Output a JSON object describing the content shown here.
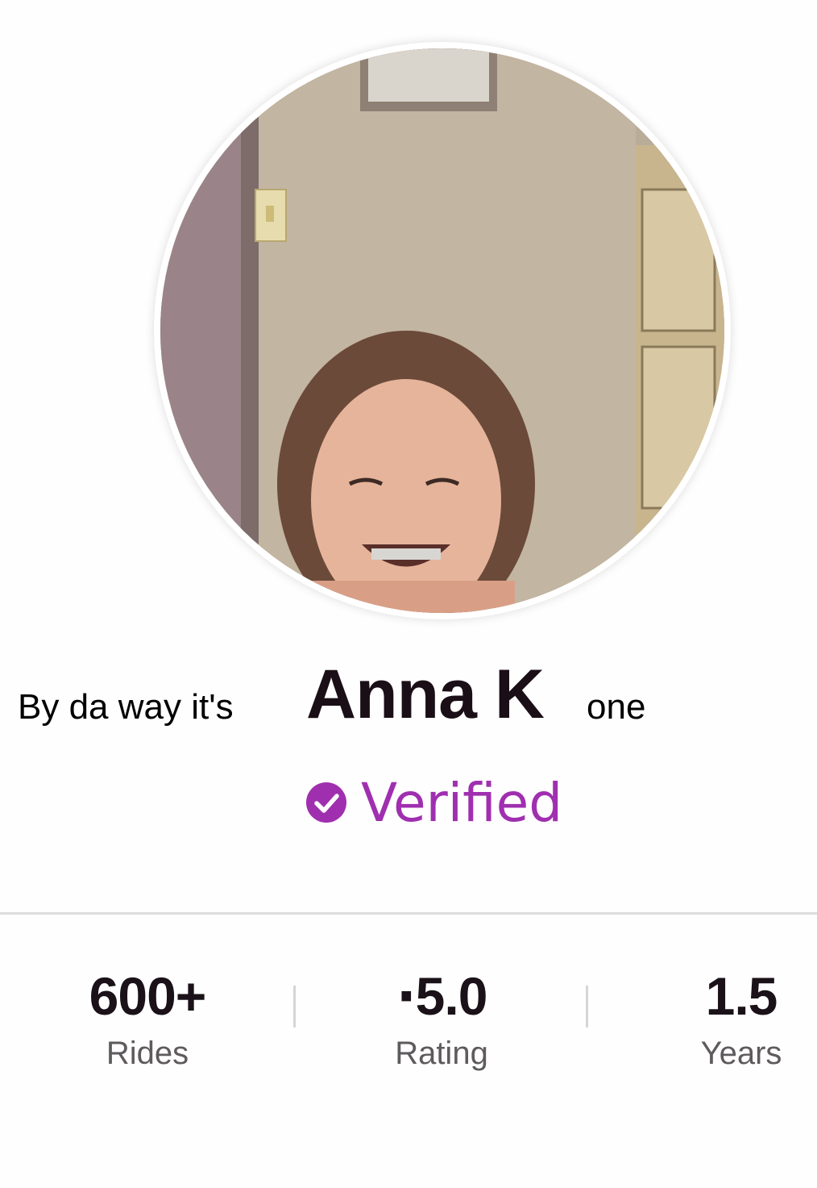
{
  "profile": {
    "name_prefix": "By da way it's",
    "name_main": "Anna K",
    "name_suffix": "one",
    "verified_label": "Verified",
    "accent_color": "#a02fb0"
  },
  "stats": [
    {
      "value": "600+",
      "label": "Rides"
    },
    {
      "value": "⋅5.0",
      "label": "Rating"
    },
    {
      "value": "1.5",
      "label": "Years"
    }
  ],
  "icons": {
    "verified": "check-circle-icon",
    "rating": "star-icon"
  }
}
